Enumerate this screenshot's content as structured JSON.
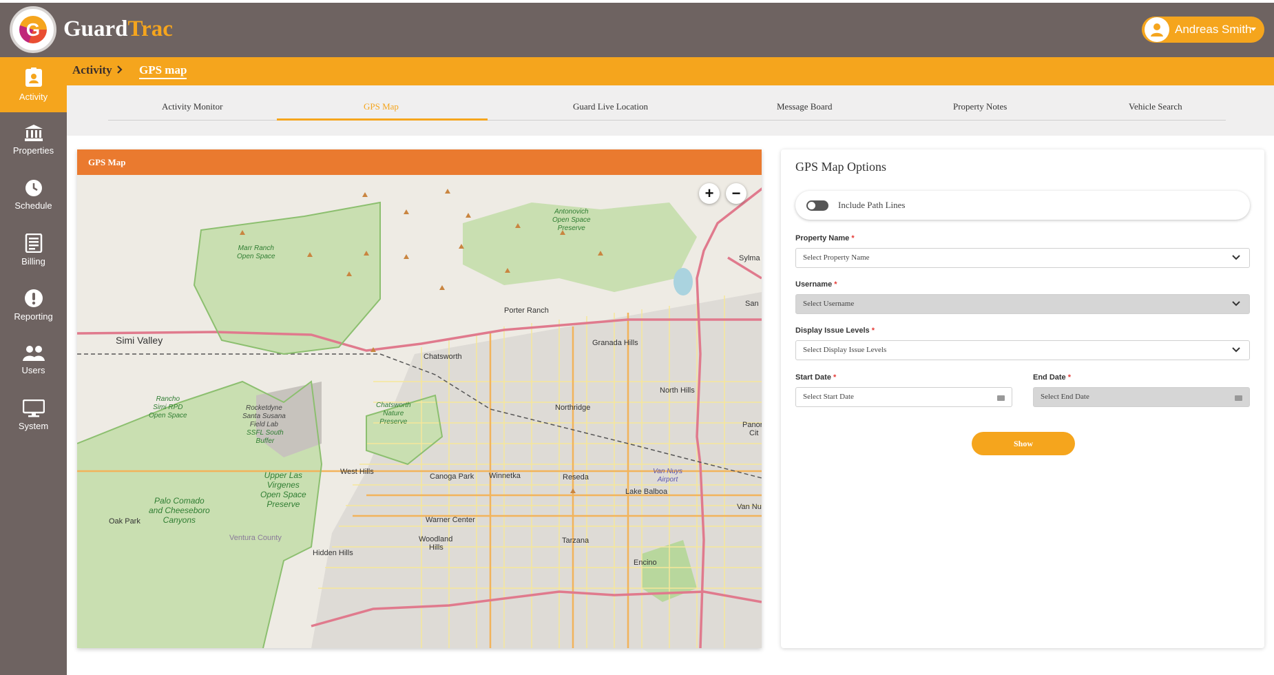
{
  "app": {
    "brand_part1": "Guard",
    "brand_part2": "Trac",
    "logo_letter": "G"
  },
  "user": {
    "name": "Andreas Smith"
  },
  "sidebar": {
    "items": [
      {
        "label": "Activity",
        "icon": "id-badge-icon"
      },
      {
        "label": "Properties",
        "icon": "bank-icon"
      },
      {
        "label": "Schedule",
        "icon": "clock-icon"
      },
      {
        "label": "Billing",
        "icon": "invoice-icon"
      },
      {
        "label": "Reporting",
        "icon": "alert-circle-icon"
      },
      {
        "label": "Users",
        "icon": "users-icon"
      },
      {
        "label": "System",
        "icon": "monitor-icon"
      }
    ]
  },
  "breadcrumb": {
    "parent": "Activity",
    "current": "GPS map"
  },
  "tabs": [
    {
      "label": "Activity Monitor"
    },
    {
      "label": "GPS Map"
    },
    {
      "label": "Guard Live Location"
    },
    {
      "label": "Message Board"
    },
    {
      "label": "Property Notes"
    },
    {
      "label": "Vehicle Search"
    }
  ],
  "map_card": {
    "title": "GPS Map",
    "zoom_in": "+",
    "zoom_out": "−",
    "places": {
      "simi_valley": "Simi Valley",
      "chatsworth": "Chatsworth",
      "porter_ranch": "Porter Ranch",
      "granada_hills": "Granada Hills",
      "north_hills": "North Hills",
      "northridge": "Northridge",
      "west_hills": "West Hills",
      "canoga_park": "Canoga Park",
      "winnetka": "Winnetka",
      "reseda": "Reseda",
      "lake_balboa": "Lake Balboa",
      "warner_center": "Warner Center",
      "woodland": "Woodland",
      "hills": "Hills",
      "tarzana": "Tarzana",
      "encino": "Encino",
      "oak_park": "Oak Park",
      "hidden_hills": "Hidden Hills",
      "ventura_county": "Ventura County",
      "sylma": "Sylma",
      "san": "San",
      "panor": "Panor",
      "cit": "Cit",
      "van_nu": "Van Nu"
    },
    "parks": {
      "marr_ranch": [
        "Marr Ranch",
        "Open Space"
      ],
      "antonovich": [
        "Antonovich",
        "Open Space",
        "Preserve"
      ],
      "rancho_simi": [
        "Rancho",
        "Simi RPD",
        "Open Space"
      ],
      "rocketdyne": [
        "Rocketdyne",
        "Santa Susana",
        "Field Lab"
      ],
      "ssfl": [
        "SSFL South",
        "Buffer"
      ],
      "chatsworth_nature": [
        "Chatsworth",
        "Nature",
        "Preserve"
      ],
      "upper_las_virgenes": [
        "Upper Las",
        "Virgenes",
        "Open Space",
        "Preserve"
      ],
      "palo_comado": [
        "Palo Comado",
        "and Cheeseboro",
        "Canyons"
      ],
      "van_nuys_airport": [
        "Van Nuys",
        "Airport"
      ]
    }
  },
  "options": {
    "title": "GPS Map Options",
    "path_lines_label": "Include Path Lines",
    "property_label": "Property Name",
    "property_placeholder": "Select Property Name",
    "username_label": "Username",
    "username_placeholder": "Select Username",
    "issue_label": "Display Issue Levels",
    "issue_placeholder": "Select Display Issue Levels",
    "start_label": "Start Date",
    "start_placeholder": "Select Start Date",
    "end_label": "End Date",
    "end_placeholder": "Select End Date",
    "required_mark": "*",
    "show_button": "Show"
  },
  "colors": {
    "accent": "#f5a51d",
    "header": "#6e6361",
    "map_header": "#ea7a2f"
  }
}
